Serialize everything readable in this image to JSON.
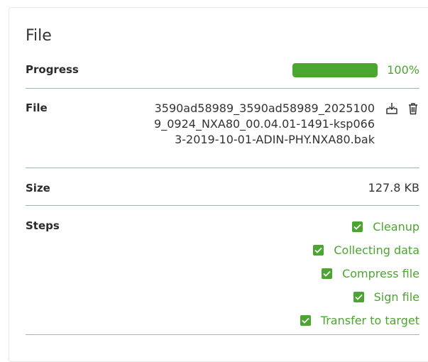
{
  "panel": {
    "title": "File"
  },
  "progress": {
    "label": "Progress",
    "value_percent": 100,
    "value_text": "100%",
    "bar_color": "#4ba530"
  },
  "file": {
    "label": "File",
    "name": "3590ad58989_3590ad58989_20251009_0924_NXA80_00.04.01-1491-ksp0663-2019-10-01-ADIN-PHY.NXA80.bak",
    "download_icon": "download-icon",
    "delete_icon": "trash-icon"
  },
  "size": {
    "label": "Size",
    "value": "127.8 KB"
  },
  "steps": {
    "label": "Steps",
    "items": [
      {
        "label": "Cleanup",
        "checked": true
      },
      {
        "label": "Collecting data",
        "checked": true
      },
      {
        "label": "Compress file",
        "checked": true
      },
      {
        "label": "Sign file",
        "checked": true
      },
      {
        "label": "Transfer to target",
        "checked": true
      }
    ]
  },
  "colors": {
    "accent": "#4ba530",
    "divider": "#9fb8ad"
  }
}
